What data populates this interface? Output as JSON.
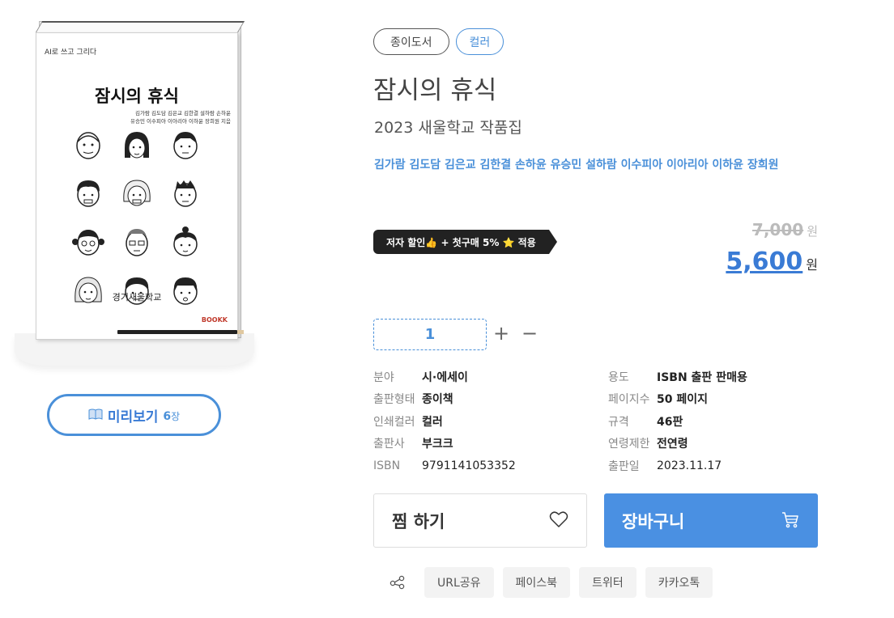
{
  "cover": {
    "series": "AI로 쓰고 그리다",
    "title": "잠시의 휴식",
    "authors_line1": "김가람 김도담 김은교 김한결 설하람 손하윤",
    "authors_line2": "유승민 이수피아 이아리아 이하윤 장희원 지음",
    "school": "경기새울학교",
    "publisher_logo": "BOOKK"
  },
  "preview": {
    "icon": "open-book-icon",
    "label": "미리보기",
    "count": "6",
    "unit": "장"
  },
  "tags": [
    "종이도서",
    "컬러"
  ],
  "title": "잠시의 휴식",
  "subtitle": "2023 새울학교 작품집",
  "authors": "김가람 김도담 김은교 김한결 손하윤 유승민 설하람 이수피아 이아리아 이하윤 장희원",
  "promo": "저자 할인👍 + 첫구매 5% ⭐ 적용",
  "price": {
    "original": "7,000",
    "original_unit": "원",
    "sale": "5,600",
    "sale_unit": "원"
  },
  "quantity": {
    "value": "1",
    "plus": "+",
    "minus": "−"
  },
  "specs": [
    {
      "key": "분야",
      "value": "시·에세이"
    },
    {
      "key": "용도",
      "value": "ISBN 출판 판매용"
    },
    {
      "key": "출판형태",
      "value": "종이책"
    },
    {
      "key": "페이지수",
      "value": "50 페이지"
    },
    {
      "key": "인쇄컬러",
      "value": "컬러"
    },
    {
      "key": "규격",
      "value": "46판"
    },
    {
      "key": "출판사",
      "value": "부크크"
    },
    {
      "key": "연령제한",
      "value": "전연령"
    },
    {
      "key": "ISBN",
      "value": "9791141053352"
    },
    {
      "key": "출판일",
      "value": "2023.11.17"
    }
  ],
  "actions": {
    "wish_label": "찜 하기",
    "wish_icon": "heart-icon",
    "cart_label": "장바구니",
    "cart_icon": "cart-icon"
  },
  "share": {
    "icon": "share-icon",
    "buttons": [
      "URL공유",
      "페이스북",
      "트위터",
      "카카오톡"
    ]
  },
  "colors": {
    "accent": "#4a90e2",
    "promo_bg": "#222222"
  }
}
